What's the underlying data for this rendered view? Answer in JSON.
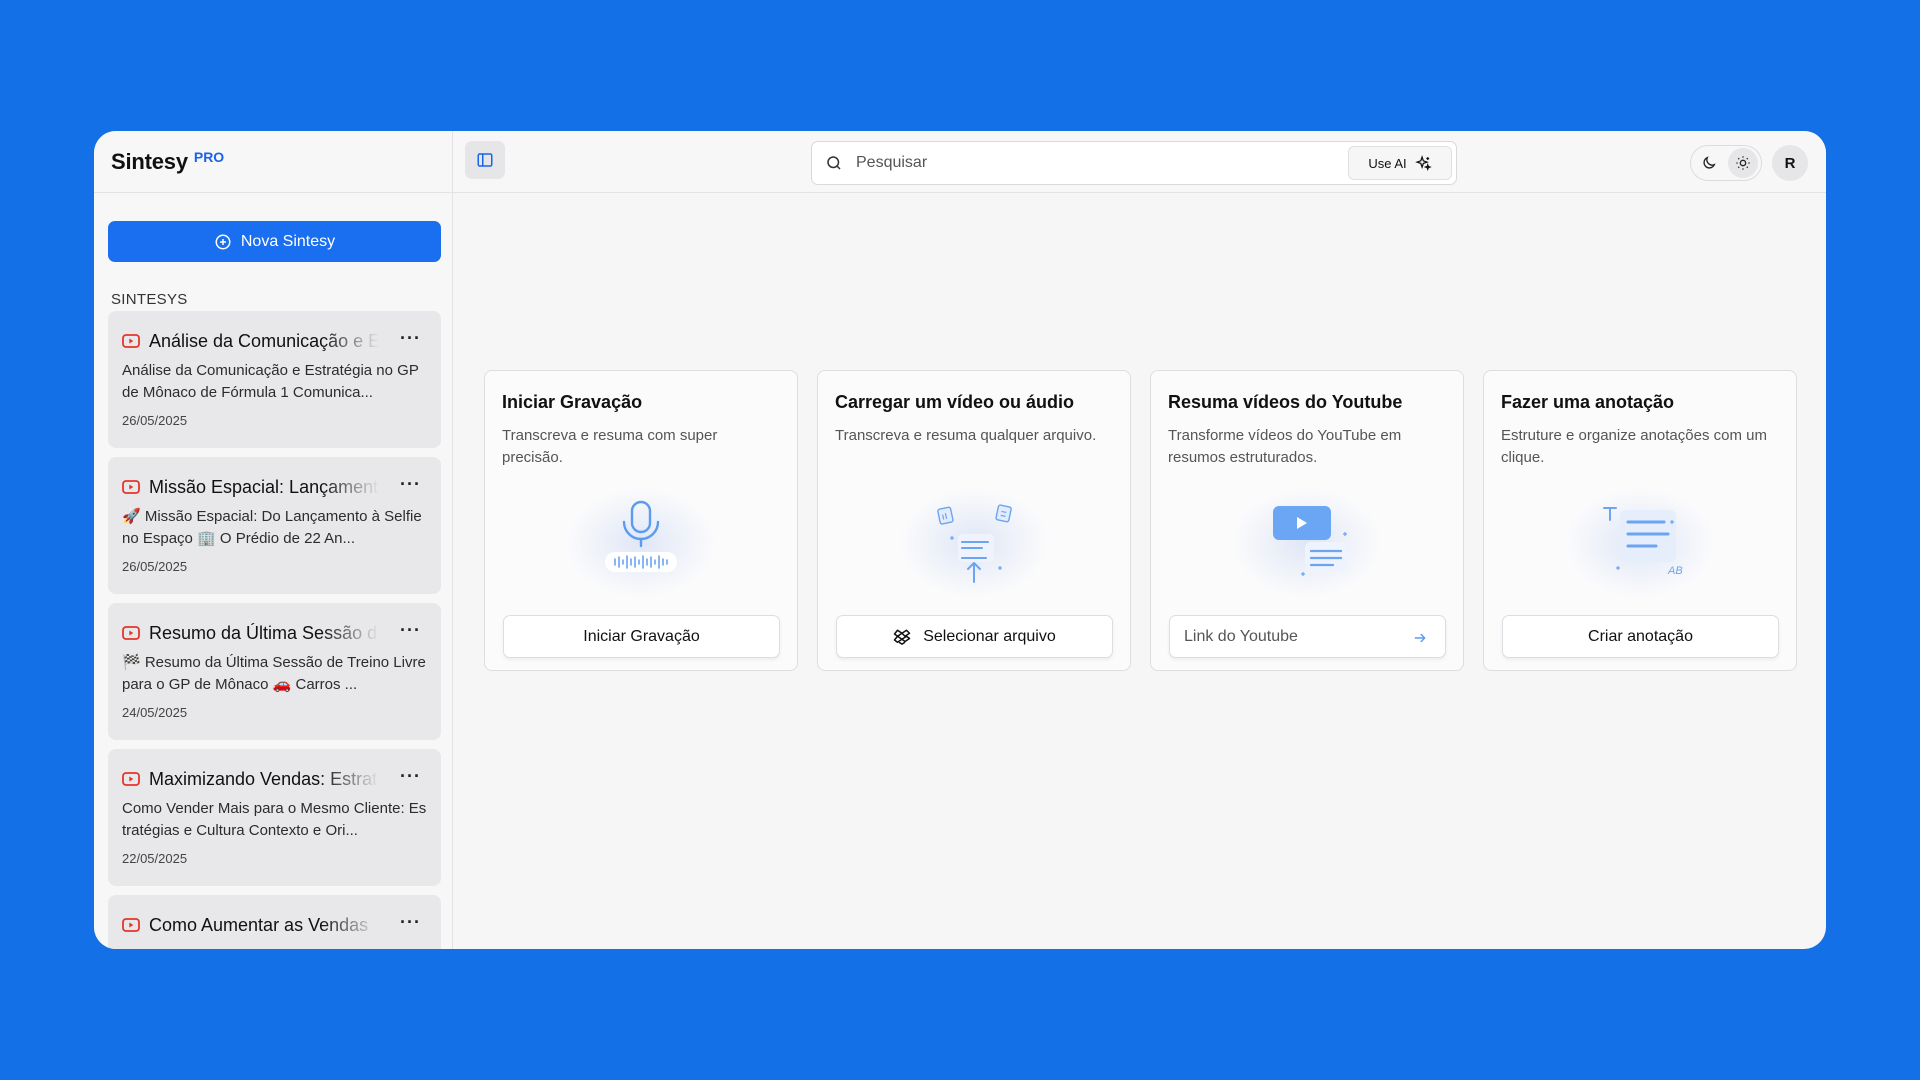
{
  "brand": {
    "name": "Sintesy",
    "badge": "PRO"
  },
  "sidebar": {
    "new_button": "Nova Sintesy",
    "section_label": "SINTESYS",
    "items": [
      {
        "title": "Análise da Comunicação e Estratégia",
        "preview": "Análise da Comunicação e Estratégia no GP de Mônaco de Fórmula 1 Comunica...",
        "date": "26/05/2025"
      },
      {
        "title": "Missão Espacial: Lançamento",
        "preview": "🚀 Missão Espacial: Do Lançamento à Selfie no Espaço 🏢 O Prédio de 22 An...",
        "date": "26/05/2025"
      },
      {
        "title": "Resumo da Última Sessão de",
        "preview": "🏁 Resumo da Última Sessão de Treino Livre para o GP de Mônaco 🚗 Carros ...",
        "date": "24/05/2025"
      },
      {
        "title": "Maximizando Vendas: Estratégias",
        "preview": "Como Vender Mais para o Mesmo Cliente: Estratégias e Cultura Contexto e Ori...",
        "date": "22/05/2025"
      },
      {
        "title": "Como Aumentar as Vendas",
        "preview": "",
        "date": ""
      }
    ]
  },
  "topbar": {
    "search_placeholder": "Pesquisar",
    "use_ai_label": "Use AI",
    "avatar_initial": "R"
  },
  "features": [
    {
      "title": "Iniciar Gravação",
      "description": "Transcreva e resuma com super precisão.",
      "action": "Iniciar Gravação",
      "icon": "microphone-icon"
    },
    {
      "title": "Carregar um vídeo ou áudio",
      "description": "Transcreva e resuma qualquer arquivo.",
      "action": "Selecionar arquivo",
      "icon": "file-upload-icon"
    },
    {
      "title": "Resuma vídeos do Youtube",
      "description": "Transforme vídeos do YouTube em resumos estruturados.",
      "action_placeholder": "Link do Youtube",
      "icon": "youtube-play-icon"
    },
    {
      "title": "Fazer uma anotação",
      "description": "Estruture e organize anotações com um clique.",
      "action": "Criar anotação",
      "icon": "note-icon"
    }
  ],
  "colors": {
    "background": "#1470e6",
    "accent": "#1a6ef0",
    "youtube_red": "#e5352b"
  }
}
